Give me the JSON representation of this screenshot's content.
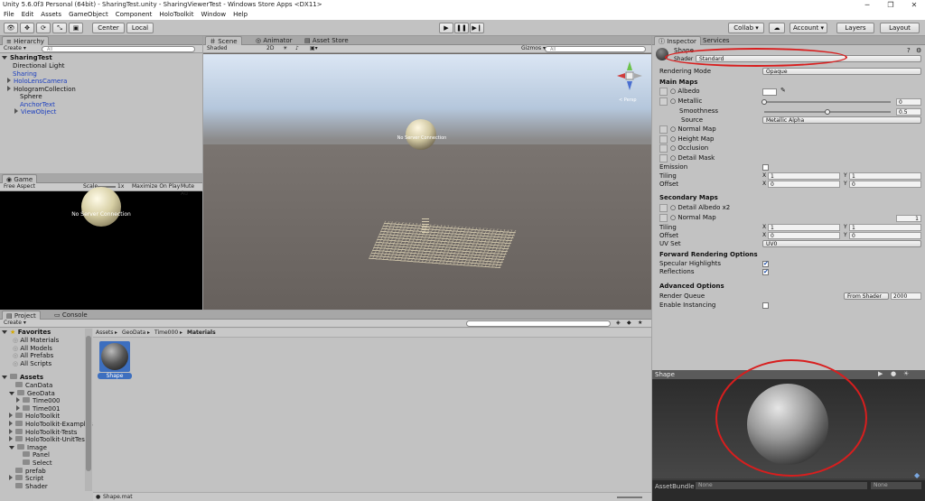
{
  "window": {
    "title": "Unity 5.6.0f3 Personal (64bit) - SharingTest.unity - SharingViewerTest - Windows Store Apps <DX11>",
    "minimize": "─",
    "maximize": "❐",
    "close": "✕"
  },
  "menu": [
    "File",
    "Edit",
    "Assets",
    "GameObject",
    "Component",
    "HoloToolkit",
    "Window",
    "Help"
  ],
  "toolbar": {
    "pivot_center": "Center",
    "pivot_local": "Local",
    "collab": "Collab ▾",
    "account": "Account ▾",
    "layers": "Layers",
    "layout": "Layout"
  },
  "hierarchy": {
    "tab": "Hierarchy",
    "create": "Create ▾",
    "search_placeholder": "All",
    "scene": "SharingTest",
    "items": [
      {
        "label": "Directional Light",
        "indent": 1,
        "blue": false,
        "arrow": false
      },
      {
        "label": "Sharing",
        "indent": 1,
        "blue": true,
        "arrow": false
      },
      {
        "label": "HoloLensCamera",
        "indent": 1,
        "blue": true,
        "arrow": true
      },
      {
        "label": "HologramCollection",
        "indent": 1,
        "blue": false,
        "arrow": true
      },
      {
        "label": "Sphere",
        "indent": 2,
        "blue": false,
        "arrow": false
      },
      {
        "label": "AnchorText",
        "indent": 2,
        "blue": true,
        "arrow": false
      },
      {
        "label": "ViewObject",
        "indent": 2,
        "blue": true,
        "arrow": true
      }
    ]
  },
  "scene": {
    "tabs": [
      "Scene",
      "Animator",
      "Asset Store"
    ],
    "shading": "Shaded",
    "mode_2d": "2D",
    "gizmos": "Gizmos ▾",
    "search_placeholder": "All",
    "persp": "< Persp",
    "sphere_text": "No Server Connection"
  },
  "game": {
    "tab": "Game",
    "aspect": "Free Aspect",
    "scale_label": "Scale",
    "scale_value": "1x",
    "maximize": "Maximize On Play",
    "mute": "Mute Au",
    "message": "No Server Connection"
  },
  "inspector": {
    "tabs": [
      "Inspector",
      "Services"
    ],
    "name": "Shape",
    "shader_label": "Shader",
    "shader_value": "Standard",
    "rendering_mode_label": "Rendering Mode",
    "rendering_mode_value": "Opaque",
    "main_maps": "Main Maps",
    "albedo": "Albedo",
    "metallic": "Metallic",
    "metallic_value": "0",
    "metallic_level": 0,
    "smoothness": "Smoothness",
    "smoothness_value": "0.5",
    "smoothness_level": 0.5,
    "source": "Source",
    "source_value": "Metallic Alpha",
    "normal_map": "Normal Map",
    "height_map": "Height Map",
    "occlusion": "Occlusion",
    "detail_mask": "Detail Mask",
    "emission": "Emission",
    "tiling": "Tiling",
    "offset": "Offset",
    "x": "X",
    "y": "Y",
    "tiling_x": "1",
    "tiling_y": "1",
    "offset_x": "0",
    "offset_y": "0",
    "secondary_maps": "Secondary Maps",
    "detail_albedo": "Detail Albedo x2",
    "normal_map2": "Normal Map",
    "normal_map2_value": "1",
    "tiling2_x": "1",
    "tiling2_y": "1",
    "offset2_x": "0",
    "offset2_y": "0",
    "uv_set": "UV Set",
    "uv_set_value": "UV0",
    "forward_options": "Forward Rendering Options",
    "specular": "Specular Highlights",
    "reflections": "Reflections",
    "advanced": "Advanced Options",
    "render_queue": "Render Queue",
    "render_queue_mode": "From Shader",
    "render_queue_value": "2000",
    "instancing": "Enable Instancing",
    "preview_title": "Shape",
    "asset_bundle": "AssetBundle",
    "asset_bundle_value": "None",
    "asset_bundle_variant": "None"
  },
  "project": {
    "tabs": [
      "Project",
      "Console"
    ],
    "create": "Create ▾",
    "breadcrumb": [
      "Assets",
      "GeoData",
      "Time000",
      "Materials"
    ],
    "favorites": "Favorites",
    "favorites_items": [
      "All Materials",
      "All Models",
      "All Prefabs",
      "All Scripts"
    ],
    "assets": "Assets",
    "tree": [
      {
        "label": "CanData",
        "indent": 1,
        "arrow": false
      },
      {
        "label": "GeoData",
        "indent": 1,
        "arrow": true,
        "open": true
      },
      {
        "label": "Time000",
        "indent": 2,
        "arrow": true
      },
      {
        "label": "Time001",
        "indent": 2,
        "arrow": true
      },
      {
        "label": "HoloToolkit",
        "indent": 1,
        "arrow": true
      },
      {
        "label": "HoloToolkit-Examples",
        "indent": 1,
        "arrow": true
      },
      {
        "label": "HoloToolkit-Tests",
        "indent": 1,
        "arrow": true
      },
      {
        "label": "HoloToolkit-UnitTests",
        "indent": 1,
        "arrow": true
      },
      {
        "label": "Image",
        "indent": 1,
        "arrow": true,
        "open": true
      },
      {
        "label": "Panel",
        "indent": 2,
        "arrow": false
      },
      {
        "label": "Select",
        "indent": 2,
        "arrow": false
      },
      {
        "label": "prefab",
        "indent": 1,
        "arrow": false
      },
      {
        "label": "Script",
        "indent": 1,
        "arrow": true
      },
      {
        "label": "Shader",
        "indent": 1,
        "arrow": false
      }
    ],
    "asset_name": "Shape",
    "status_file": "Shape.mat"
  },
  "colors": {
    "highlight": "#d81e1e",
    "selection": "#3d6fbf"
  }
}
